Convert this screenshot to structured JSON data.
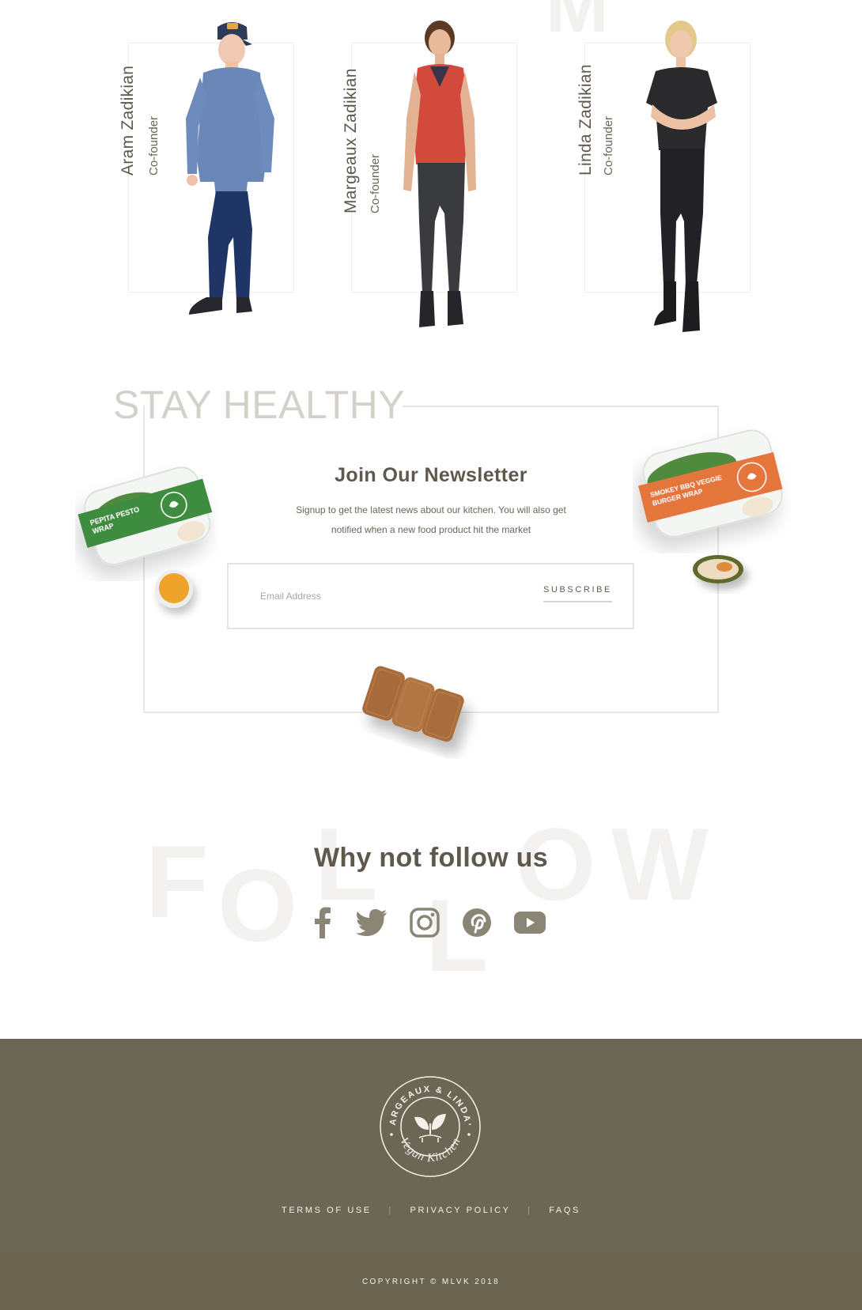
{
  "team": {
    "members": [
      {
        "name": "Aram Zadikian",
        "role": "Co-founder"
      },
      {
        "name": "Margeaux Zadikian",
        "role": "Co-founder"
      },
      {
        "name": "Linda Zadikian",
        "role": "Co-founder"
      }
    ]
  },
  "newsletter": {
    "section_title": "STAY HEALTHY",
    "title": "Join Our Newsletter",
    "description": "Signup to get the latest news about our kitchen. You will also get notified when a new food product hit the market",
    "email_placeholder": "Email Address",
    "subscribe_label": "SUBSCRIBE",
    "products": {
      "left_package": "PEPITA PESTO WRAP",
      "right_package": "SMOKEY BBQ VEGGIE BURGER WRAP"
    }
  },
  "follow": {
    "background_word": "FOLLOW",
    "title": "Why not follow us",
    "icons": [
      "facebook-icon",
      "twitter-icon",
      "instagram-icon",
      "pinterest-icon",
      "youtube-icon"
    ]
  },
  "footer": {
    "logo_text": "MARGEAUX & LINDA'S Vegan Kitchen",
    "links": [
      "TERMS OF USE",
      "PRIVACY POLICY",
      "FAQS"
    ],
    "separator": "|",
    "copyright": "COPYRIGHT © MLVK 2018"
  },
  "colors": {
    "footer_bg": "#6c6655",
    "copyright_bg": "#69634f",
    "heading_text": "#5e594c",
    "faded_heading": "#d3d1ca",
    "green_package": "#3d8c3f",
    "orange_package": "#e4743a"
  }
}
